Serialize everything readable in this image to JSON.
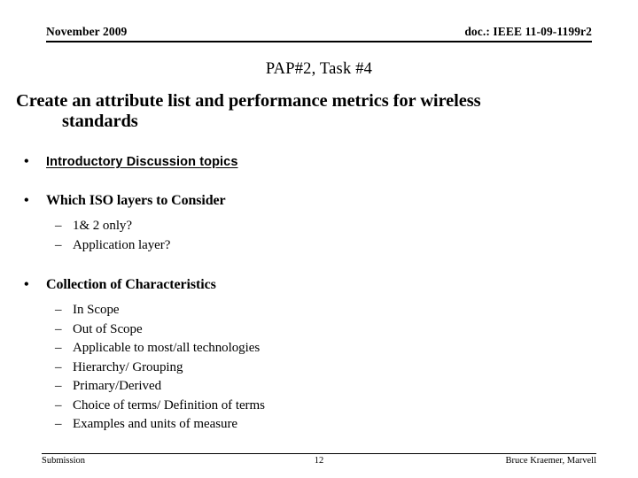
{
  "slide": {
    "header": {
      "date": "November 2009",
      "doc": "doc.: IEEE 11-09-1199r2"
    },
    "title": "PAP#2, Task #4",
    "lead": {
      "line1": "Create an attribute list and performance metrics for wireless",
      "line2": "standards"
    },
    "bullets": [
      {
        "marker": "•",
        "text": "Introductory Discussion topics",
        "style": "sans-underline",
        "children": []
      },
      {
        "marker": "•",
        "text": "Which ISO layers to Consider",
        "style": "serif",
        "children": [
          {
            "marker": "–",
            "text": "1& 2 only?"
          },
          {
            "marker": "–",
            "text": "Application layer?"
          }
        ]
      },
      {
        "marker": "•",
        "text": "Collection of Characteristics",
        "style": "serif",
        "children": [
          {
            "marker": "–",
            "text": "In Scope"
          },
          {
            "marker": "–",
            "text": "Out of Scope"
          },
          {
            "marker": "–",
            "text": "Applicable to most/all technologies"
          },
          {
            "marker": "–",
            "text": "Hierarchy/ Grouping"
          },
          {
            "marker": "–",
            "text": "Primary/Derived"
          },
          {
            "marker": "–",
            "text": "Choice of terms/ Definition of terms"
          },
          {
            "marker": "–",
            "text": "Examples and units of measure"
          }
        ]
      }
    ],
    "footer": {
      "left": "Submission",
      "page": "12",
      "right": "Bruce Kraemer, Marvell"
    },
    "colors": {
      "text": "#000000",
      "background": "#ffffff",
      "rule": "#000000"
    }
  }
}
